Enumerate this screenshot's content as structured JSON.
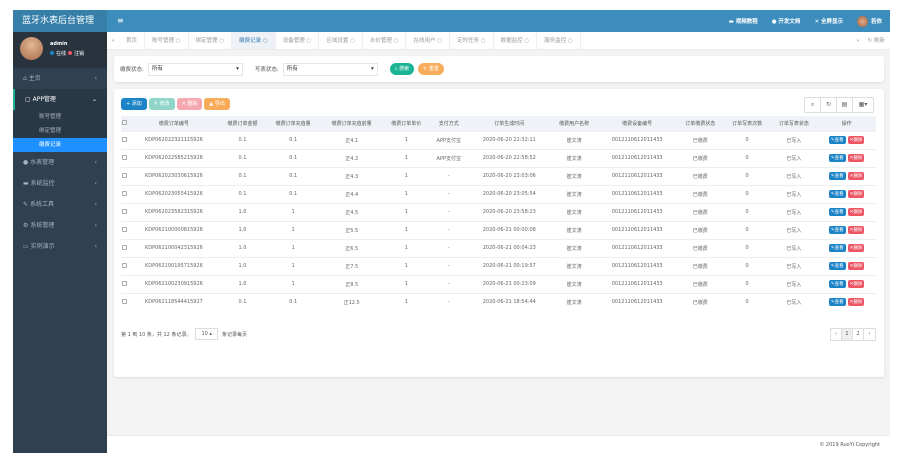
{
  "app": {
    "title": "蓝牙水表后台管理"
  },
  "user": {
    "name": "admin",
    "online": "在线",
    "logout": "注销"
  },
  "sidebar": {
    "items": [
      {
        "label": "主页",
        "icon": "home-icon"
      },
      {
        "label": "APP管理",
        "icon": "square-icon",
        "open": true,
        "children": [
          {
            "label": "账号管理"
          },
          {
            "label": "绑定管理"
          },
          {
            "label": "缴费记录",
            "active": true
          }
        ]
      },
      {
        "label": "水表管理",
        "icon": "water-drop-icon"
      },
      {
        "label": "系统监控",
        "icon": "video-icon"
      },
      {
        "label": "系统工具",
        "icon": "wrench-icon"
      },
      {
        "label": "系统管理",
        "icon": "gear-icon"
      },
      {
        "label": "实例演示",
        "icon": "monitor-icon"
      }
    ]
  },
  "header": {
    "video": "视频教程",
    "docs": "开发文档",
    "fullscreen": "全屏显示",
    "username": "若依"
  },
  "tabs": {
    "items": [
      "首页",
      "账号管理",
      "绑定管理",
      "缴费记录",
      "设备管理",
      "区域设置",
      "水价管理",
      "在线用户",
      "定时任务",
      "数据监控",
      "服务监控"
    ],
    "active": 3,
    "refresh": "刷新"
  },
  "search": {
    "pay_status_label": "缴费状态:",
    "pay_status_value": "所有",
    "write_status_label": "写表状态:",
    "write_status_value": "所有",
    "search_btn": "搜索",
    "reset_btn": "重置"
  },
  "toolbar": {
    "add": "添加",
    "edit": "修改",
    "delete": "删除",
    "export": "导出"
  },
  "colors": {
    "header": "#3c8dbc",
    "sidebar": "#2f4050",
    "primary": "#1c84c6",
    "danger": "#ed5565",
    "success": "#1ab394",
    "warning": "#f8ac59"
  },
  "table": {
    "headers": [
      "缴费订单编号",
      "缴费订单金额",
      "缴费订单充值量",
      "缴费订单充值前量",
      "缴费订单单价",
      "支付方式",
      "订单生成时间",
      "缴费用户名称",
      "缴费设备编号",
      "订单缴费状态",
      "订单写表次数",
      "订单写表状态",
      "操作"
    ],
    "edit_label": "查看",
    "delete_label": "删除",
    "rows": [
      [
        "KDP062022321115926",
        "0.1",
        "0.1",
        "正4.1",
        "1",
        "APP支付宝",
        "2020-06-20 22:32:11",
        "崔文涛",
        "0012110612011433",
        "已缴费",
        "0",
        "已写入"
      ],
      [
        "KDP062022585215926",
        "0.1",
        "0.1",
        "正4.2",
        "1",
        "APP支付宝",
        "2020-06-20 22:58:52",
        "崔文涛",
        "0012110612011433",
        "已缴费",
        "0",
        "已写入"
      ],
      [
        "KDP062023030615926",
        "0.1",
        "0.1",
        "正4.3",
        "1",
        "-",
        "2020-06-20 23:03:06",
        "崔文涛",
        "0012110612011433",
        "已缴费",
        "0",
        "已写入"
      ],
      [
        "KDP062023055415926",
        "0.1",
        "0.1",
        "正4.4",
        "1",
        "-",
        "2020-06-20 23:05:54",
        "崔文涛",
        "0012110612011433",
        "已缴费",
        "0",
        "已写入"
      ],
      [
        "KDP062023582315926",
        "1.0",
        "1",
        "正4.5",
        "1",
        "-",
        "2020-06-20 23:58:23",
        "崔文涛",
        "0012110612011433",
        "已缴费",
        "0",
        "已写入"
      ],
      [
        "KDP062100000815926",
        "1.0",
        "1",
        "正5.5",
        "1",
        "-",
        "2020-06-21 00:00:08",
        "崔文涛",
        "0012110612011433",
        "已缴费",
        "0",
        "已写入"
      ],
      [
        "KDP062100042315926",
        "1.0",
        "1",
        "正6.5",
        "1",
        "-",
        "2020-06-21 00:04:23",
        "崔文涛",
        "0012110612011433",
        "已缴费",
        "0",
        "已写入"
      ],
      [
        "KDP062100195715926",
        "1.0",
        "1",
        "正7.5",
        "1",
        "-",
        "2020-06-21 00:19:57",
        "崔文涛",
        "0012110612011433",
        "已缴费",
        "0",
        "已写入"
      ],
      [
        "KDP062100230915926",
        "1.0",
        "1",
        "正8.5",
        "1",
        "-",
        "2020-06-21 00:23:09",
        "崔文涛",
        "0012110612011433",
        "已缴费",
        "0",
        "已写入"
      ],
      [
        "KDP062118544415927",
        "0.1",
        "0.1",
        "正12.5",
        "1",
        "-",
        "2020-06-21 18:54:44",
        "崔文涛",
        "0012110612011433",
        "已缴费",
        "0",
        "已写入"
      ]
    ]
  },
  "pagination": {
    "summary": "第 1 到 10 条，共 12 条记录。",
    "page_size": "10",
    "per_page_label": "条记录每页",
    "prev": "‹",
    "pages": [
      "1",
      "2"
    ],
    "next": "›"
  },
  "footer": {
    "copyright": "© 2019 RuoYi Copyright"
  }
}
